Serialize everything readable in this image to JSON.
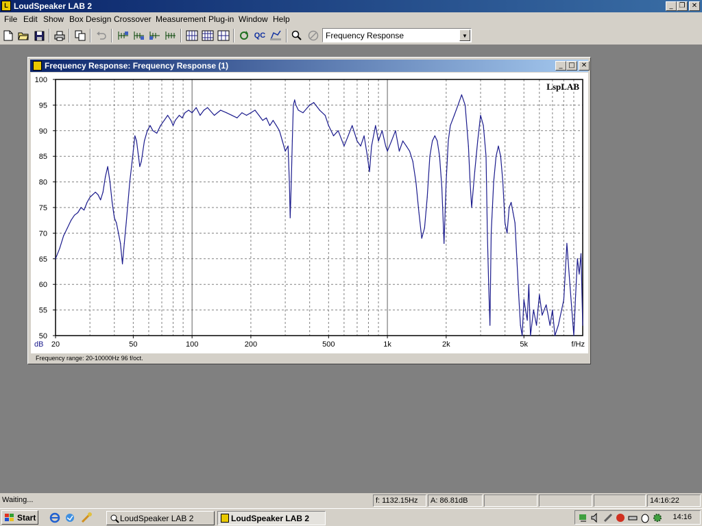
{
  "app": {
    "title": "LoudSpeaker LAB 2"
  },
  "menu": [
    "File",
    "Edit",
    "Show",
    "Box Design",
    "Crossover",
    "Measurement",
    "Plug-in",
    "Window",
    "Help"
  ],
  "toolbar": {
    "icons": [
      "new-file-icon",
      "open-folder-icon",
      "save-icon",
      "print-icon",
      "copy-icon",
      "undo-icon",
      "add-curve-icon",
      "add-curve-2-icon",
      "add-curve-3-icon",
      "add-curve-4-icon",
      "grid-tool-icon",
      "grid-tool-2-icon",
      "grid-tool-3-icon",
      "grid-tool-4-icon",
      "refresh-icon",
      "qc-icon",
      "measure-icon",
      "zoom-icon",
      "stop-icon"
    ],
    "qc_label": "QC",
    "view_select": "Frequency Response"
  },
  "child_window": {
    "title": "Frequency Response: Frequency Response (1)",
    "status": "Frequency range: 20-10000Hz  96 f/oct."
  },
  "chart_data": {
    "type": "line",
    "watermark": "LspLAB",
    "x_scale": "log",
    "xlim": [
      20,
      10000
    ],
    "ylim": [
      50,
      100
    ],
    "ylabel": "dB",
    "xlabel": "f/Hz",
    "y_ticks": [
      "100",
      "95",
      "90",
      "85",
      "80",
      "75",
      "70",
      "65",
      "60",
      "55",
      "50"
    ],
    "x_tick_labels": [
      {
        "f": 20,
        "label": "20"
      },
      {
        "f": 50,
        "label": "50"
      },
      {
        "f": 100,
        "label": "100"
      },
      {
        "f": 200,
        "label": "200"
      },
      {
        "f": 500,
        "label": "500"
      },
      {
        "f": 1000,
        "label": "1k"
      },
      {
        "f": 2000,
        "label": "2k"
      },
      {
        "f": 5000,
        "label": "5k"
      }
    ],
    "grid": true,
    "series": [
      {
        "color": "#1a1a8c",
        "points": [
          [
            20,
            65
          ],
          [
            21,
            67
          ],
          [
            22,
            69.5
          ],
          [
            23,
            71
          ],
          [
            24,
            72.5
          ],
          [
            25,
            73.5
          ],
          [
            26,
            74
          ],
          [
            27,
            75
          ],
          [
            28,
            74.5
          ],
          [
            29,
            76
          ],
          [
            30,
            77
          ],
          [
            31,
            77.5
          ],
          [
            32,
            78
          ],
          [
            33,
            77.5
          ],
          [
            34,
            76.5
          ],
          [
            35,
            78
          ],
          [
            36,
            81
          ],
          [
            37,
            83
          ],
          [
            38,
            80
          ],
          [
            39,
            76
          ],
          [
            40,
            73
          ],
          [
            41,
            72
          ],
          [
            42,
            70
          ],
          [
            43,
            68
          ],
          [
            44,
            64
          ],
          [
            45,
            68
          ],
          [
            46,
            72
          ],
          [
            47,
            76
          ],
          [
            48,
            80
          ],
          [
            50,
            86
          ],
          [
            51,
            89
          ],
          [
            52,
            88
          ],
          [
            54,
            83
          ],
          [
            55,
            84
          ],
          [
            57,
            88
          ],
          [
            59,
            90
          ],
          [
            61,
            91
          ],
          [
            63,
            90
          ],
          [
            66,
            89.5
          ],
          [
            69,
            91
          ],
          [
            72,
            92
          ],
          [
            75,
            93
          ],
          [
            78,
            92
          ],
          [
            80,
            91
          ],
          [
            82,
            92
          ],
          [
            86,
            93
          ],
          [
            89,
            92.5
          ],
          [
            92,
            93.5
          ],
          [
            96,
            94
          ],
          [
            100,
            93.5
          ],
          [
            105,
            94.5
          ],
          [
            110,
            93
          ],
          [
            115,
            94
          ],
          [
            120,
            94.5
          ],
          [
            130,
            93
          ],
          [
            140,
            94
          ],
          [
            150,
            93.5
          ],
          [
            160,
            93
          ],
          [
            170,
            92.5
          ],
          [
            180,
            93.5
          ],
          [
            190,
            93
          ],
          [
            200,
            93.5
          ],
          [
            210,
            94
          ],
          [
            220,
            93
          ],
          [
            230,
            92
          ],
          [
            240,
            92.5
          ],
          [
            250,
            91
          ],
          [
            260,
            92
          ],
          [
            270,
            91
          ],
          [
            280,
            90
          ],
          [
            290,
            88
          ],
          [
            300,
            86
          ],
          [
            310,
            87
          ],
          [
            315,
            80
          ],
          [
            318,
            73
          ],
          [
            322,
            80
          ],
          [
            326,
            88
          ],
          [
            330,
            95
          ],
          [
            335,
            96
          ],
          [
            340,
            95
          ],
          [
            350,
            94
          ],
          [
            370,
            93.5
          ],
          [
            400,
            95
          ],
          [
            420,
            95.5
          ],
          [
            450,
            94
          ],
          [
            480,
            93
          ],
          [
            500,
            91
          ],
          [
            530,
            89
          ],
          [
            560,
            90
          ],
          [
            600,
            87
          ],
          [
            630,
            89
          ],
          [
            660,
            91
          ],
          [
            700,
            88
          ],
          [
            730,
            87
          ],
          [
            760,
            89
          ],
          [
            790,
            85
          ],
          [
            810,
            82
          ],
          [
            830,
            87
          ],
          [
            870,
            91
          ],
          [
            900,
            88
          ],
          [
            940,
            90
          ],
          [
            980,
            87
          ],
          [
            1000,
            86
          ],
          [
            1050,
            88
          ],
          [
            1100,
            90
          ],
          [
            1150,
            86
          ],
          [
            1200,
            88
          ],
          [
            1250,
            87
          ],
          [
            1300,
            86
          ],
          [
            1350,
            84
          ],
          [
            1400,
            80
          ],
          [
            1450,
            74
          ],
          [
            1500,
            69
          ],
          [
            1550,
            71
          ],
          [
            1600,
            77
          ],
          [
            1650,
            85
          ],
          [
            1700,
            88
          ],
          [
            1750,
            89
          ],
          [
            1800,
            88
          ],
          [
            1850,
            85
          ],
          [
            1900,
            79
          ],
          [
            1950,
            68
          ],
          [
            2000,
            80
          ],
          [
            2050,
            88
          ],
          [
            2100,
            91
          ],
          [
            2200,
            93
          ],
          [
            2300,
            95
          ],
          [
            2400,
            97
          ],
          [
            2500,
            95
          ],
          [
            2600,
            87
          ],
          [
            2650,
            80
          ],
          [
            2700,
            75
          ],
          [
            2800,
            82
          ],
          [
            2900,
            88
          ],
          [
            3000,
            93
          ],
          [
            3100,
            91
          ],
          [
            3200,
            85
          ],
          [
            3250,
            70
          ],
          [
            3300,
            60
          ],
          [
            3350,
            52
          ],
          [
            3400,
            70
          ],
          [
            3500,
            80
          ],
          [
            3600,
            85
          ],
          [
            3700,
            87
          ],
          [
            3800,
            85
          ],
          [
            3900,
            80
          ],
          [
            4000,
            72
          ],
          [
            4100,
            70
          ],
          [
            4200,
            75
          ],
          [
            4300,
            76
          ],
          [
            4400,
            74
          ],
          [
            4500,
            72
          ],
          [
            4600,
            65
          ],
          [
            4700,
            58
          ],
          [
            4800,
            52
          ],
          [
            4900,
            50
          ],
          [
            5000,
            57
          ],
          [
            5200,
            53
          ],
          [
            5300,
            60
          ],
          [
            5400,
            50
          ],
          [
            5600,
            55
          ],
          [
            5800,
            52
          ],
          [
            6000,
            58
          ],
          [
            6200,
            54
          ],
          [
            6500,
            56
          ],
          [
            6800,
            52
          ],
          [
            7000,
            55
          ],
          [
            7200,
            50
          ],
          [
            7500,
            52
          ],
          [
            8000,
            57
          ],
          [
            8300,
            68
          ],
          [
            8600,
            60
          ],
          [
            9000,
            50
          ],
          [
            9200,
            58
          ],
          [
            9400,
            65
          ],
          [
            9600,
            62
          ],
          [
            9800,
            66
          ],
          [
            10000,
            52
          ]
        ]
      }
    ]
  },
  "status_bar": {
    "left": "Waiting...",
    "freq": "f: 1132.15Hz",
    "amp": "A: 86.81dB",
    "time": "14:16:22"
  },
  "taskbar": {
    "start": "Start",
    "tasks": [
      "LoudSpeaker LAB 2",
      "LoudSpeaker LAB 2"
    ],
    "clock": "14:16"
  }
}
